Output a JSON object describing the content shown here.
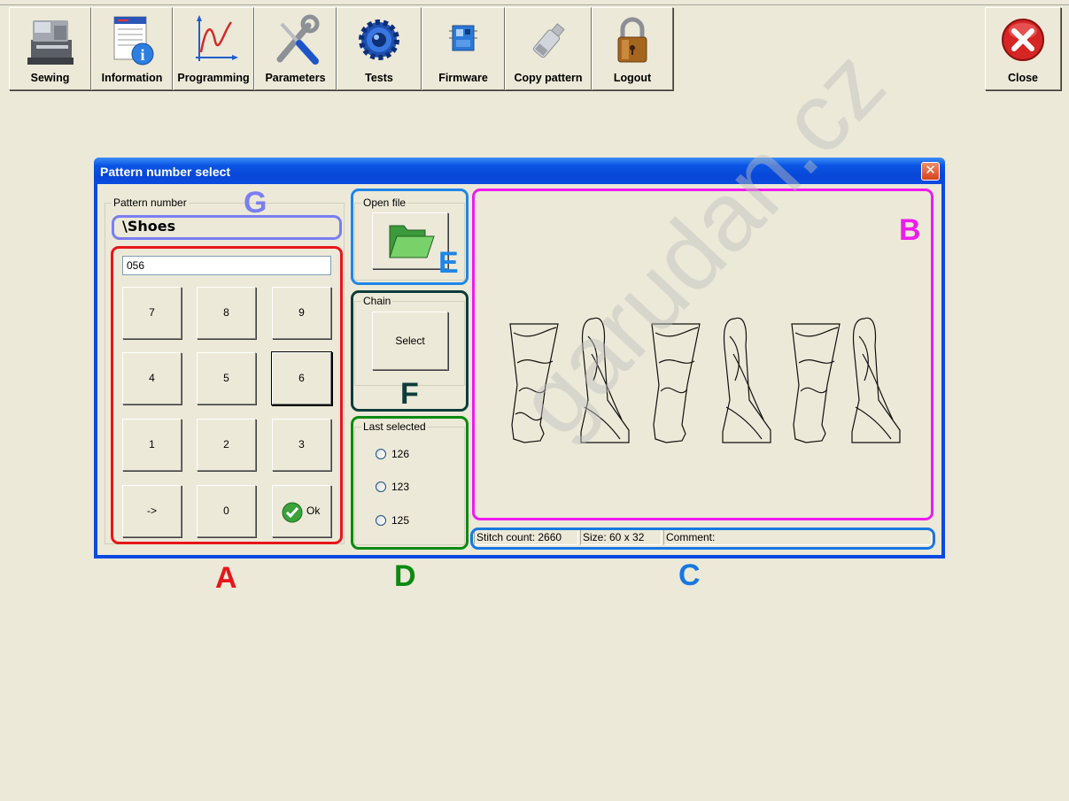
{
  "toolbar": {
    "buttons": [
      {
        "label": "Sewing",
        "icon": "sewing-machine-icon"
      },
      {
        "label": "Information",
        "icon": "information-icon"
      },
      {
        "label": "Programming",
        "icon": "programming-graph-icon"
      },
      {
        "label": "Parameters",
        "icon": "wrench-screwdriver-icon"
      },
      {
        "label": "Tests",
        "icon": "gear-speaker-icon"
      },
      {
        "label": "Firmware",
        "icon": "chip-board-icon"
      },
      {
        "label": "Copy pattern",
        "icon": "usb-stick-icon"
      },
      {
        "label": "Logout",
        "icon": "padlock-icon"
      }
    ],
    "close_label": "Close"
  },
  "dialog": {
    "title": "Pattern number select",
    "close_glyph": "✕",
    "pattern_group": {
      "title": "Pattern number",
      "folder": "\\Shoes",
      "number_value": "056",
      "keys": [
        "7",
        "8",
        "9",
        "4",
        "5",
        "6",
        "1",
        "2",
        "3",
        "->",
        "0"
      ],
      "ok_label": "Ok"
    },
    "open_file": {
      "title": "Open file"
    },
    "chain": {
      "title": "Chain",
      "select_label": "Select"
    },
    "last_selected": {
      "title": "Last selected",
      "items": [
        "126",
        "123",
        "125"
      ]
    },
    "status": {
      "stitch_count": "Stitch count: 2660",
      "size": "Size: 60 x 32",
      "comment": "Comment:"
    }
  },
  "annotations": {
    "A": "A",
    "B": "B",
    "C": "C",
    "D": "D",
    "E": "E",
    "F": "F",
    "G": "G",
    "colors": {
      "A": "#e8161b",
      "B": "#ee1bee",
      "C": "#1878e0",
      "D": "#0c8a10",
      "E": "#1f86e8",
      "F": "#0c3d3a",
      "G": "#7a7ef0"
    }
  },
  "watermark": "garudan.cz",
  "colors": {
    "titlebar": "#0a4ae0",
    "window": "#ece9d8"
  }
}
